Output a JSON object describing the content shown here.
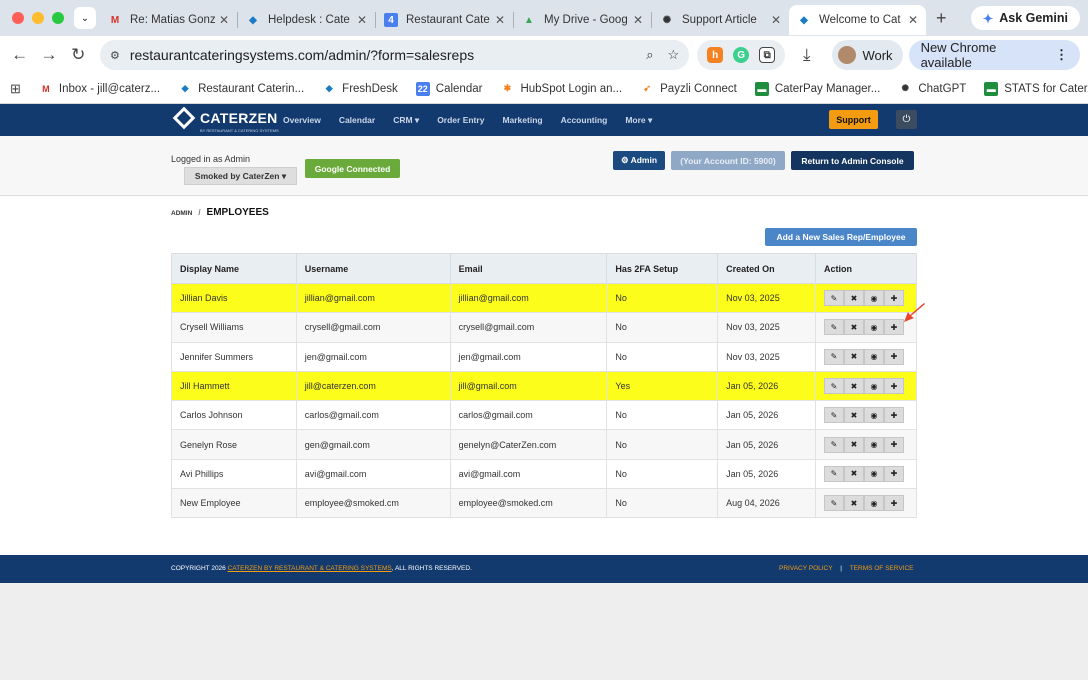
{
  "browser": {
    "tabs": [
      {
        "title": "Re: Matias Gonz",
        "icon": "gmail-icon",
        "active": false
      },
      {
        "title": "Helpdesk : Cate",
        "icon": "freshdesk-icon",
        "active": false
      },
      {
        "title": "Restaurant Cate",
        "icon": "calendar-icon",
        "active": false
      },
      {
        "title": "My Drive - Goog",
        "icon": "drive-icon",
        "active": false
      },
      {
        "title": "Support Article",
        "icon": "openai-icon",
        "active": false
      },
      {
        "title": "Welcome to Cat",
        "icon": "freshdesk-icon",
        "active": true
      }
    ],
    "ask_gemini": "Ask Gemini",
    "url": "restaurantcateringsystems.com/admin/?form=salesreps",
    "profile": "Work",
    "new_chrome": "New Chrome available",
    "bookmarks": [
      {
        "label": "Inbox - jill@caterz...",
        "icon": "gmail-icon"
      },
      {
        "label": "Restaurant Caterin...",
        "icon": "freshdesk-icon"
      },
      {
        "label": "FreshDesk",
        "icon": "freshdesk-icon"
      },
      {
        "label": "Calendar",
        "icon": "calendar-icon"
      },
      {
        "label": "HubSpot Login an...",
        "icon": "hubspot-icon"
      },
      {
        "label": "Payzli Connect",
        "icon": "payzli-icon"
      },
      {
        "label": "CaterPay Manager...",
        "icon": "sheet-icon"
      },
      {
        "label": "ChatGPT",
        "icon": "openai-icon"
      },
      {
        "label": "STATS for CaterZe...",
        "icon": "sheet-icon"
      }
    ],
    "calendar_day": "22",
    "tab_calendar_day": "4"
  },
  "app": {
    "logo": "CATERZEN",
    "logo_tag": "BY RESTAURANT & CATERING SYSTEMS",
    "menu": [
      "Overview",
      "Calendar",
      "CRM ▾",
      "Order Entry",
      "Marketing",
      "Accounting",
      "More ▾"
    ],
    "support": "Support",
    "logged_in": "Logged in as Admin",
    "company": "Smoked by CaterZen ▾",
    "google_connected": "Google Connected",
    "admin_btn": "⚙ Admin",
    "account_id": "(Your Account ID: 5900)",
    "return_console": "Return to Admin Console",
    "breadcrumb_root": "ADMIN",
    "breadcrumb_sep": "/",
    "breadcrumb_current": "EMPLOYEES",
    "add_button": "Add a New Sales Rep/Employee",
    "columns": [
      "Display Name",
      "Username",
      "Email",
      "Has 2FA Setup",
      "Created On",
      "Action"
    ],
    "rows": [
      {
        "name": "Jillian Davis",
        "username": "jillian@gmail.com",
        "email": "jillian@gmail.com",
        "twofa": "No",
        "created": "Nov 03, 2025",
        "highlight": true
      },
      {
        "name": "Crysell Williams",
        "username": "crysell@gmail.com",
        "email": "crysell@gmail.com",
        "twofa": "No",
        "created": "Nov 03, 2025",
        "highlight": false
      },
      {
        "name": "Jennifer Summers",
        "username": "jen@gmail.com",
        "email": "jen@gmail.com",
        "twofa": "No",
        "created": "Nov 03, 2025",
        "highlight": false
      },
      {
        "name": "Jill Hammett",
        "username": "jill@caterzen.com",
        "email": "jill@gmail.com",
        "twofa": "Yes",
        "created": "Jan 05, 2026",
        "highlight": true
      },
      {
        "name": "Carlos Johnson",
        "username": "carlos@gmail.com",
        "email": "carlos@gmail.com",
        "twofa": "No",
        "created": "Jan 05, 2026",
        "highlight": false
      },
      {
        "name": "Genelyn Rose",
        "username": "gen@gmail.com",
        "email": "genelyn@CaterZen.com",
        "twofa": "No",
        "created": "Jan 05, 2026",
        "highlight": false
      },
      {
        "name": "Avi Phillips",
        "username": "avi@gmail.com",
        "email": "avi@gmail.com",
        "twofa": "No",
        "created": "Jan 05, 2026",
        "highlight": false
      },
      {
        "name": "New Employee",
        "username": "employee@smoked.cm",
        "email": "employee@smoked.cm",
        "twofa": "No",
        "created": "Aug 04, 2026",
        "highlight": false
      }
    ],
    "action_icons": [
      "✎",
      "✖",
      "◉",
      "✚"
    ],
    "footer_copy": "COPYRIGHT 2026",
    "footer_link": "CATERZEN BY RESTAURANT & CATERING SYSTEMS",
    "footer_rights": ", ALL RIGHTS RESERVED.",
    "privacy": "PRIVACY POLICY",
    "footer_sep": "|",
    "terms": "TERMS OF SERVICE"
  },
  "colors": {
    "navbar": "#123a6e",
    "support": "#f39c12",
    "highlight": "#fdfd1c",
    "google": "#6aaa3a",
    "add_button": "#4a86c8",
    "arrow": "#e8452c"
  }
}
